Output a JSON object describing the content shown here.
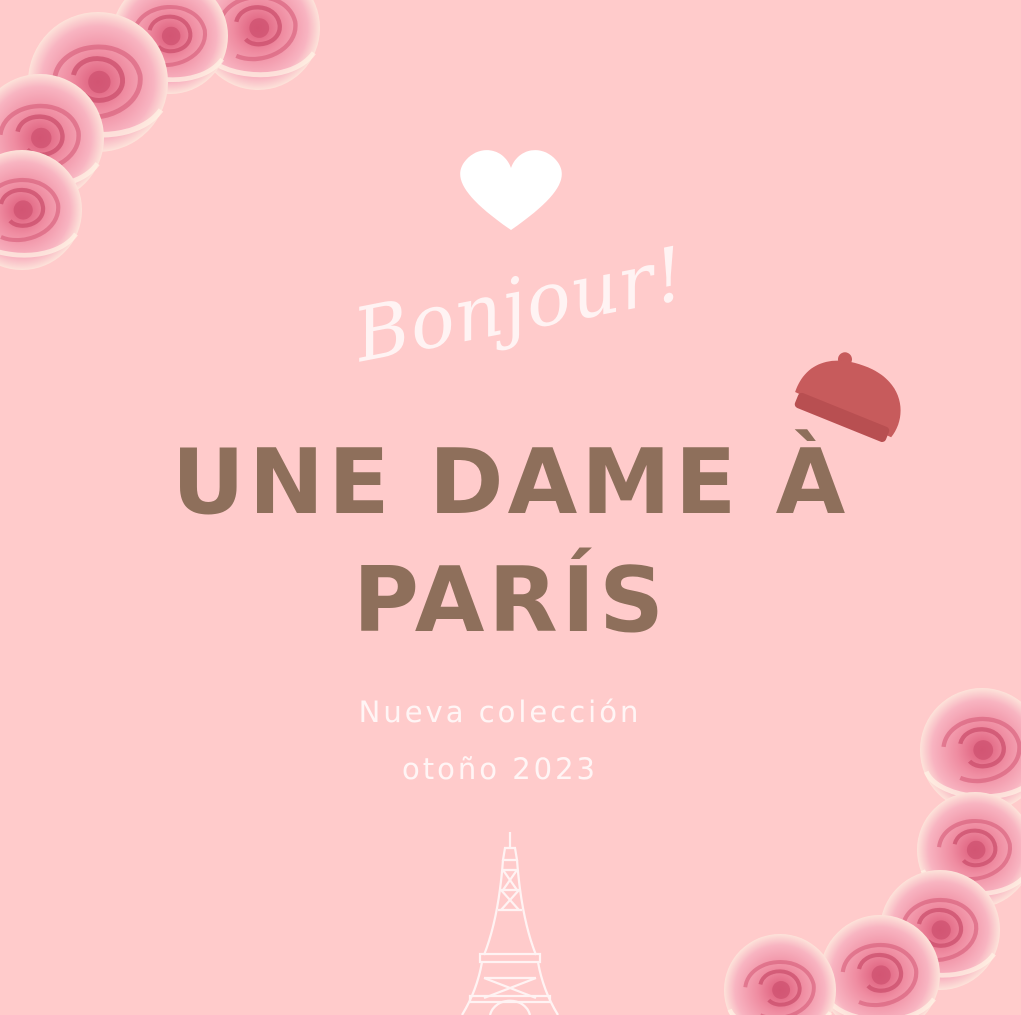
{
  "poster": {
    "greeting": "Bonjour!",
    "title_line1": "UNE DAME À",
    "title_line2": "PARÍS",
    "subtitle_line1": "Nueva colección",
    "subtitle_line2": "otoño 2023"
  },
  "colors": {
    "background": "#ffcbcb",
    "title": "#8e6f5b",
    "beret": "#c75b5c",
    "heart": "#ffffff",
    "rose": "#f48fa5"
  },
  "icons": [
    "heart-icon",
    "beret-icon",
    "eiffel-tower-icon",
    "rose-icon"
  ]
}
